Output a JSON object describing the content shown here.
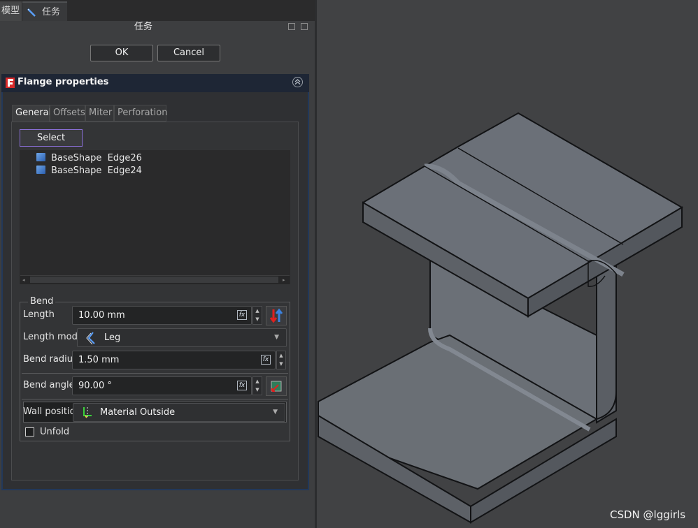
{
  "top_tabs": {
    "model": "模型",
    "tasks": "任务"
  },
  "panel": {
    "title": "任务",
    "ok_label": "OK",
    "cancel_label": "Cancel"
  },
  "flange": {
    "title": "Flange properties",
    "tabs": [
      "General",
      "Offsets",
      "Miter",
      "Perforation"
    ],
    "select_label": "Select",
    "edges": [
      "BaseShape  Edge26",
      "BaseShape  Edge24"
    ],
    "bend": {
      "group_label": "Bend",
      "length_label": "Length",
      "length_value": "10.00 mm",
      "length_mode_label": "Length mode",
      "length_mode_value": "Leg",
      "bend_radius_label": "Bend radius",
      "bend_radius_value": "1.50 mm",
      "bend_angle_label": "Bend angle",
      "bend_angle_value": "90.00 °",
      "wall_position_label": "Wall positio",
      "wall_position_value": "Material Outside",
      "unfold_label": "Unfold"
    }
  },
  "watermark": "CSDN @lggirls",
  "colors": {
    "accent": "#8a6fd6",
    "header_bg": "#1e2635",
    "model_face_top": "#6a6f76",
    "model_edge": "#111214"
  }
}
